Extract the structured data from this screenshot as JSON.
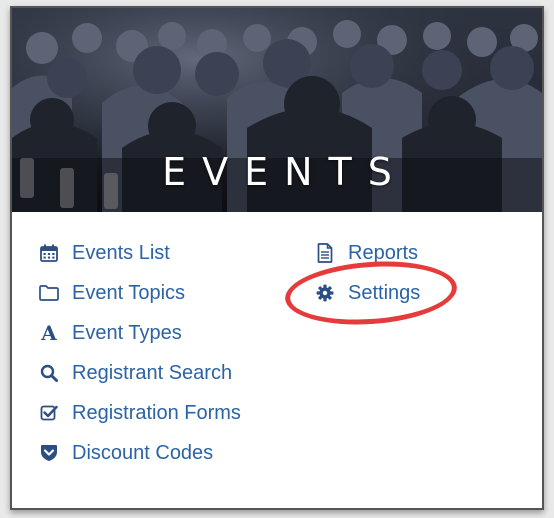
{
  "banner": {
    "title": "EVENTS"
  },
  "menu": {
    "left": [
      {
        "label": "Events List",
        "icon": "calendar-icon"
      },
      {
        "label": "Event Topics",
        "icon": "folder-icon"
      },
      {
        "label": "Event Types",
        "icon": "letter-a-icon",
        "glyph": "A"
      },
      {
        "label": "Registrant Search",
        "icon": "search-icon"
      },
      {
        "label": "Registration Forms",
        "icon": "checkbox-icon"
      },
      {
        "label": "Discount Codes",
        "icon": "tag-shield-icon"
      }
    ],
    "right": [
      {
        "label": "Reports",
        "icon": "document-icon"
      },
      {
        "label": "Settings",
        "icon": "gear-icon"
      }
    ]
  },
  "colors": {
    "link": "#2b63a6",
    "icon": "#2b4f84",
    "highlight": "#e63b3b"
  }
}
